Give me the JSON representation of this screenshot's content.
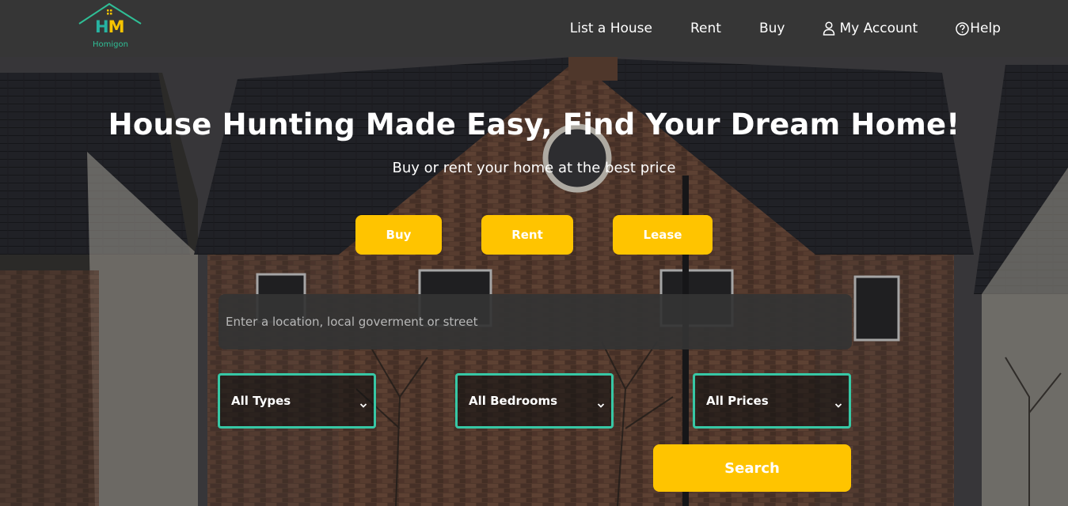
{
  "brand": {
    "logo_letters": "HM",
    "name": "Homigon"
  },
  "nav": {
    "items": [
      {
        "label": "List a House"
      },
      {
        "label": "Rent"
      },
      {
        "label": "Buy"
      },
      {
        "label": "My Account",
        "icon": "user-icon"
      },
      {
        "label": "Help",
        "icon": "help-circle-icon"
      }
    ]
  },
  "hero": {
    "title": "House Hunting Made Easy, Find Your Dream Home!",
    "subtitle": "Buy or rent your home at the best price"
  },
  "modes": {
    "buy": "Buy",
    "rent": "Rent",
    "lease": "Lease"
  },
  "search": {
    "placeholder": "Enter a location, local goverment or street",
    "button_label": "Search"
  },
  "filters": {
    "types": "All Types",
    "bedrooms": "All Bedrooms",
    "prices": "All Prices"
  },
  "colors": {
    "accent": "#ffc400",
    "outline": "#37c7a5",
    "header_bg": "#363636"
  }
}
